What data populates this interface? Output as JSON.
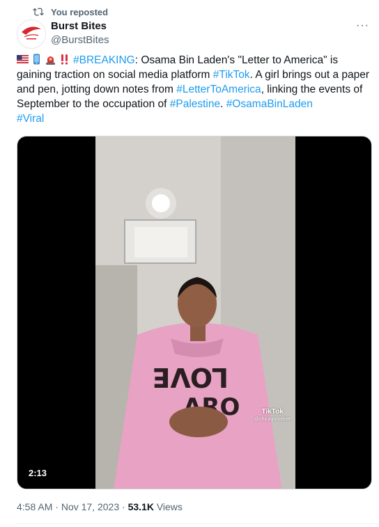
{
  "repost": {
    "label": "You reposted",
    "icon": "repost-icon"
  },
  "account": {
    "name": "Burst Bites",
    "handle": "@BurstBites",
    "avatar_icon": "burst-bites-logo"
  },
  "menu": {
    "icon": "more-icon",
    "glyph": "···"
  },
  "tweet": {
    "emojis": [
      "us-flag-emoji",
      "mobile-phone-emoji",
      "siren-emoji",
      "double-exclamation-emoji"
    ],
    "hashtag_breaking": "#BREAKING",
    "text_1": ": Osama Bin Laden's \"Letter to America\" is gaining  traction on social media platform ",
    "hashtag_tiktok": "#TikTok",
    "text_2": ". A girl brings out a paper and pen, jotting down notes from ",
    "hashtag_letter": "#LetterToAmerica",
    "text_3": ", linking the events of September to the occupation of ",
    "hashtag_palestine": "#Palestine",
    "text_4": ". ",
    "hashtag_osama": "#OsamaBinLaden",
    "hashtag_viral": "#Viral"
  },
  "video": {
    "duration": "2:13",
    "watermark": "TikTok",
    "watermark_user": "@chicagohottiee"
  },
  "meta": {
    "time": "4:58 AM",
    "sep": " · ",
    "date": "Nov 17, 2023",
    "views_count": "53.1K",
    "views_label": " Views"
  },
  "colors": {
    "link": "#1d9bf0",
    "muted": "#536471",
    "text": "#0f1419"
  }
}
